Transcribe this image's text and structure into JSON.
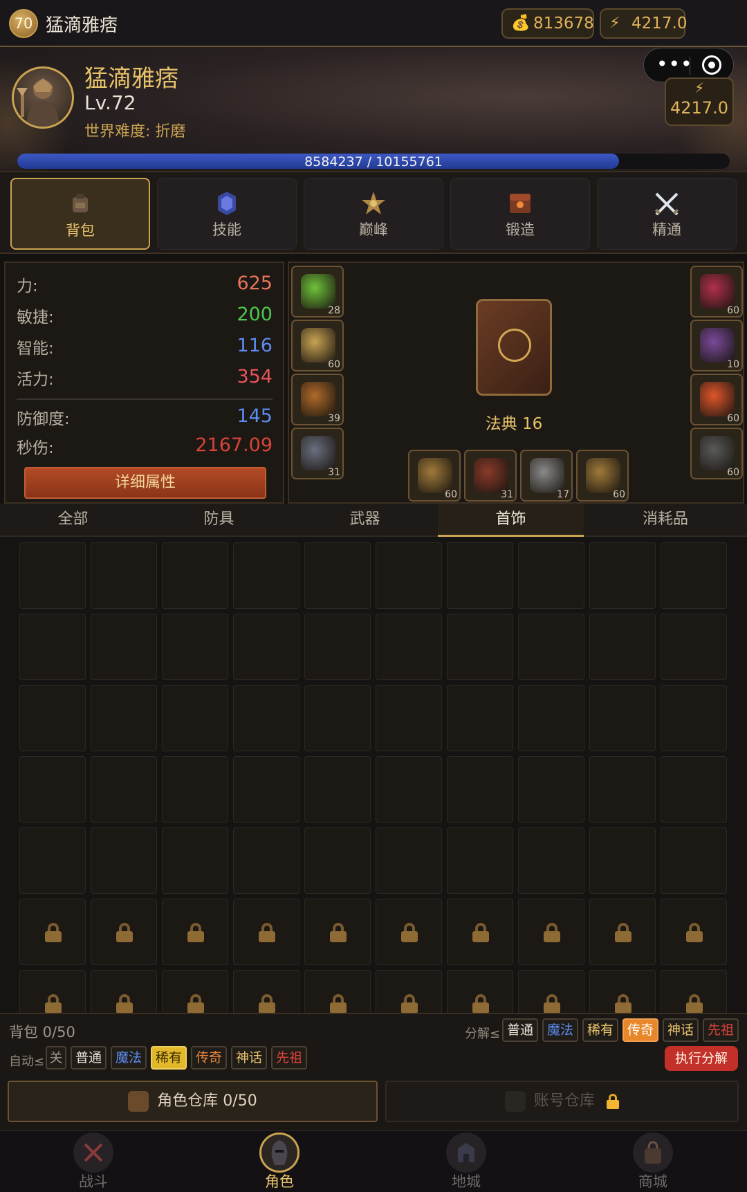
{
  "topbar": {
    "level": "70",
    "name": "猛滴雅痞",
    "gold": "813678",
    "energy": "4217.0"
  },
  "hero": {
    "name": "猛滴雅痞",
    "level": "Lv.72",
    "difficulty": "世界难度: 折磨",
    "energy": "4217.0",
    "xp_text": "8584237 / 10155761",
    "xp_progress": 0.845
  },
  "tabs": [
    {
      "label": "背包",
      "icon": "backpack-icon",
      "active": true
    },
    {
      "label": "技能",
      "icon": "skill-rune-icon",
      "active": false
    },
    {
      "label": "巅峰",
      "icon": "paragon-star-icon",
      "active": false
    },
    {
      "label": "锻造",
      "icon": "forge-chest-icon",
      "active": false
    },
    {
      "label": "精通",
      "icon": "crossed-swords-icon",
      "active": false
    }
  ],
  "stats": {
    "strength": {
      "label": "力:",
      "value": "625",
      "color": "#e8765a"
    },
    "dexterity": {
      "label": "敏捷:",
      "value": "200",
      "color": "#4cc94c"
    },
    "intelligence": {
      "label": "智能:",
      "value": "116",
      "color": "#5c8df0"
    },
    "vitality": {
      "label": "活力:",
      "value": "354",
      "color": "#e8565a"
    },
    "defense": {
      "label": "防御度:",
      "value": "145",
      "color": "#5c8df0"
    },
    "dps": {
      "label": "秒伤:",
      "value": "2167.09",
      "color": "#d9443a"
    },
    "detail_button": "详细属性"
  },
  "equipment": {
    "left_slots": [
      {
        "name": "helmet-slot",
        "level": "28",
        "color": "#6fc23a"
      },
      {
        "name": "chest-slot",
        "level": "60",
        "color": "#c9a352"
      },
      {
        "name": "gloves-slot",
        "level": "39",
        "color": "#b06a2a"
      },
      {
        "name": "pants-slot",
        "level": "31",
        "color": "#6a6f80"
      }
    ],
    "right_slots": [
      {
        "name": "amulet-slot",
        "level": "60",
        "color": "#b0304a"
      },
      {
        "name": "ring-slot-1",
        "level": "10",
        "color": "#7a4a9a"
      },
      {
        "name": "ring-slot-2",
        "level": "60",
        "color": "#e0562a"
      },
      {
        "name": "boots-slot",
        "level": "60",
        "color": "#5a5a5a"
      }
    ],
    "bottom_slots": [
      {
        "name": "weapon-slot-1",
        "level": "60",
        "color": "#a07a3a"
      },
      {
        "name": "weapon-slot-2",
        "level": "31",
        "color": "#8a3a2a"
      },
      {
        "name": "weapon-slot-3",
        "level": "17",
        "color": "#8a8a8a"
      },
      {
        "name": "weapon-slot-4",
        "level": "60",
        "color": "#a07a3a"
      }
    ],
    "codex_label": "法典 16"
  },
  "categories": [
    {
      "label": "全部",
      "active": false
    },
    {
      "label": "防具",
      "active": false
    },
    {
      "label": "武器",
      "active": false
    },
    {
      "label": "首饰",
      "active": true
    },
    {
      "label": "消耗品",
      "active": false
    }
  ],
  "inventory": {
    "columns": 10,
    "open_rows": 5,
    "locked_rows": 2
  },
  "actions": {
    "bag_count": "背包 0/50",
    "salvage_label": "分解≤",
    "auto_label": "自动≤",
    "salvage_chips": [
      {
        "label": "普通",
        "color": "#e8e2d6",
        "selected": false
      },
      {
        "label": "魔法",
        "color": "#5c8df0",
        "selected": false
      },
      {
        "label": "稀有",
        "color": "#e7c36a",
        "selected": false
      },
      {
        "label": "传奇",
        "color": "#ffffff",
        "selected": true
      },
      {
        "label": "神话",
        "color": "#e7c36a",
        "selected": false
      },
      {
        "label": "先祖",
        "color": "#d9443a",
        "selected": false
      }
    ],
    "auto_chips": [
      {
        "label": "关",
        "color": "#9f978b",
        "selected": false
      },
      {
        "label": "普通",
        "color": "#e8e2d6",
        "selected": false
      },
      {
        "label": "魔法",
        "color": "#5c8df0",
        "selected": false
      },
      {
        "label": "稀有",
        "color": "#3a2a00",
        "selected": true
      },
      {
        "label": "传奇",
        "color": "#e8863a",
        "selected": false
      },
      {
        "label": "神话",
        "color": "#e7c36a",
        "selected": false
      },
      {
        "label": "先祖",
        "color": "#d9443a",
        "selected": false
      }
    ],
    "execute_button": "执行分解",
    "role_warehouse": "角色仓库 0/50",
    "account_warehouse": "账号仓库"
  },
  "nav": [
    {
      "label": "战斗",
      "icon": "battle-icon",
      "active": false
    },
    {
      "label": "角色",
      "icon": "character-helmet-icon",
      "active": true
    },
    {
      "label": "地城",
      "icon": "dungeon-icon",
      "active": false
    },
    {
      "label": "商城",
      "icon": "shop-bag-icon",
      "active": false
    }
  ]
}
